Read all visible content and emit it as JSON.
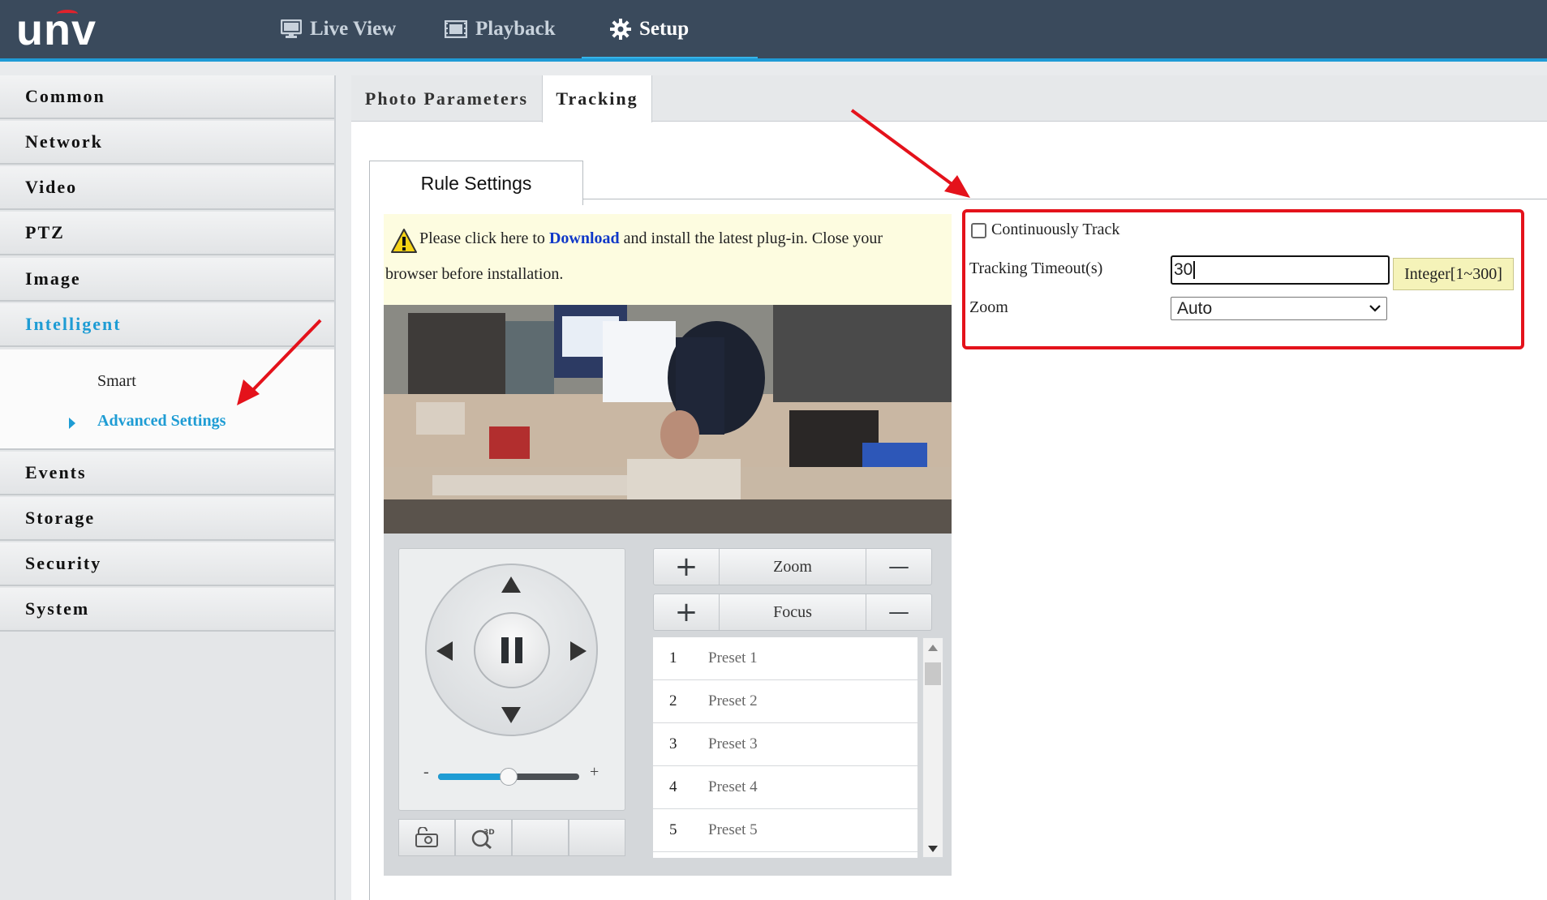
{
  "brand": {
    "logo_text": "unv",
    "accent": "#e0222c"
  },
  "topnav": {
    "items": [
      {
        "label": "Live View",
        "icon": "monitor-icon"
      },
      {
        "label": "Playback",
        "icon": "film-icon"
      },
      {
        "label": "Setup",
        "icon": "gear-icon",
        "active": true
      }
    ]
  },
  "sidebar": {
    "items": [
      {
        "label": "Common"
      },
      {
        "label": "Network"
      },
      {
        "label": "Video"
      },
      {
        "label": "PTZ"
      },
      {
        "label": "Image"
      },
      {
        "label": "Intelligent",
        "active": true
      },
      {
        "label": "Events"
      },
      {
        "label": "Storage"
      },
      {
        "label": "Security"
      },
      {
        "label": "System"
      }
    ],
    "subitems": [
      {
        "label": "Smart"
      },
      {
        "label": "Advanced Settings",
        "active": true
      }
    ]
  },
  "tabs": [
    {
      "label": "Photo Parameters"
    },
    {
      "label": "Tracking",
      "active": true
    }
  ],
  "subtab": {
    "label": "Rule Settings"
  },
  "notice": {
    "part1": "Please click here to ",
    "link": "Download",
    "part2": " and install the latest plug-in. Close your",
    "line2": "browser before installation."
  },
  "ptz": {
    "speed_min": "-",
    "speed_max": "+",
    "speed_level": 0.5,
    "zoom_label": "Zoom",
    "focus_label": "Focus",
    "plus": "+",
    "minus": "—",
    "presets": [
      {
        "num": "1",
        "name": "Preset 1"
      },
      {
        "num": "2",
        "name": "Preset 2"
      },
      {
        "num": "3",
        "name": "Preset 3"
      },
      {
        "num": "4",
        "name": "Preset 4"
      },
      {
        "num": "5",
        "name": "Preset 5"
      }
    ]
  },
  "tracking": {
    "continuous_label": "Continuously Track",
    "continuous_checked": false,
    "timeout_label": "Tracking Timeout(s)",
    "timeout_value": "30",
    "timeout_hint": "Integer[1~300]",
    "zoom_label": "Zoom",
    "zoom_value": "Auto"
  },
  "colors": {
    "highlight_box": "#e4121b",
    "active_blue": "#1e9cd4",
    "topbar": "#3a4a5c"
  }
}
